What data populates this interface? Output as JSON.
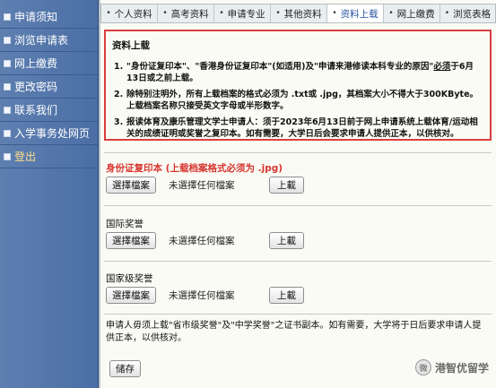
{
  "sidebar": {
    "items": [
      {
        "label": "申请须知"
      },
      {
        "label": "浏览申请表"
      },
      {
        "label": "网上缴费"
      },
      {
        "label": "更改密码"
      },
      {
        "label": "联系我们"
      },
      {
        "label": "入学事务处网页"
      },
      {
        "label": "登出"
      }
    ]
  },
  "topnav": {
    "tabs": [
      {
        "label": "个人资料"
      },
      {
        "label": "高考资料"
      },
      {
        "label": "申请专业"
      },
      {
        "label": "其他资料"
      },
      {
        "label": "资料上载"
      },
      {
        "label": "网上缴费"
      },
      {
        "label": "浏览表格"
      }
    ],
    "bullet": "•"
  },
  "notice": {
    "title": "资料上载",
    "items": [
      {
        "num": "1.",
        "pre": "\"身份证复印本\"、\"香港身份证复印本\"(如适用)及\"申请来港修读本科专业的原因\"",
        "emph": "必须",
        "post": "于6月13日或之前上载。"
      },
      {
        "num": "2.",
        "text": "除特别注明外，所有上载档案的格式必须为 .txt或 .jpg，其档案大小不得大于300KByte。上载档案名称只接受英文字母或半形数字。"
      },
      {
        "num": "3.",
        "text": "报读体育及康乐管理文学士申请人：须于2023年6月13日前于网上申请系统上载体育/运动相关的成绩证明或奖誉之复印本。如有需要，大学日后会要求申请人提供正本，以供核对。"
      }
    ]
  },
  "uploads": [
    {
      "label": "身份证复印本 (上载档案格式必须为 .jpg)",
      "choose": "選擇檔案",
      "status": "未選擇任何檔案",
      "upload": "上載"
    },
    {
      "label": "国际奖誉",
      "choose": "選擇檔案",
      "status": "未選擇任何檔案",
      "upload": "上載"
    },
    {
      "label": "国家级奖誉",
      "choose": "選擇檔案",
      "status": "未選擇任何檔案",
      "upload": "上載"
    }
  ],
  "footnote": "申请人毋须上载\"省市级奖誉\"及\"中学奖誉\"之证书副本。如有需要，大学将于日后要求申请人提供正本，以供核对。",
  "save_label": "储存",
  "watermark": {
    "icon": "微",
    "text": "港智优留学"
  }
}
